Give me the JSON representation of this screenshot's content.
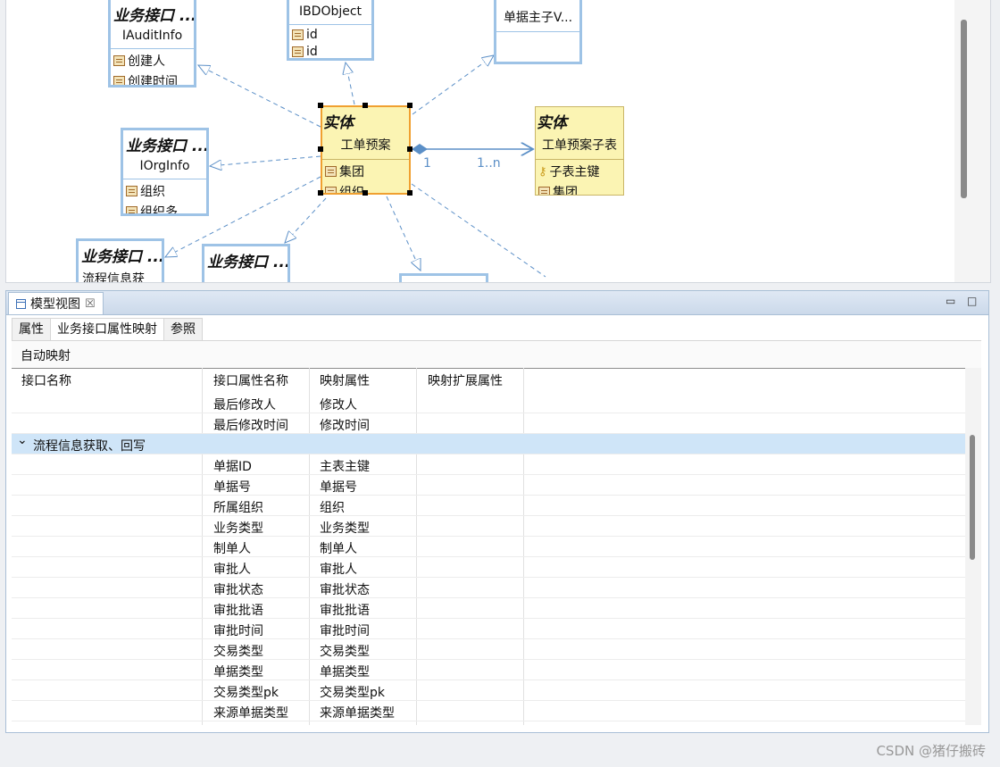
{
  "diagram": {
    "boxes": {
      "iaudit": {
        "stereotype": "业务接口 ...",
        "name": "IAuditInfo",
        "attrs": [
          "创建人",
          "创建时间"
        ]
      },
      "ibdobject": {
        "name": "IBDObject",
        "attrs": [
          "id",
          "id"
        ]
      },
      "billmain": {
        "name": "单据主子V..."
      },
      "iorg": {
        "stereotype": "业务接口 ...",
        "name": "IOrgInfo",
        "attrs": [
          "组织",
          "组织多"
        ]
      },
      "flowinfo": {
        "stereotype": "业务接口 ...",
        "name": "流程信息获"
      },
      "biz5": {
        "stereotype": "业务接口 ..."
      },
      "entity_main": {
        "stereotype": "实体",
        "name": "工单预案",
        "attrs": [
          "集团",
          "组织"
        ]
      },
      "entity_child": {
        "stereotype": "实体",
        "name": "工单预案子表",
        "attrs": [
          "子表主键",
          "集团"
        ]
      }
    },
    "multiplicity_left": "1",
    "multiplicity_right": "1..n"
  },
  "panel": {
    "title": "模型视图",
    "close": "☒",
    "minimize": "▭",
    "maximize": "□",
    "tabs": [
      "属性",
      "业务接口属性映射",
      "参照"
    ],
    "toolbar_label": "自动映射",
    "columns": [
      "接口名称",
      "接口属性名称",
      "映射属性",
      "映射扩展属性"
    ],
    "rows": [
      {
        "interface": "",
        "attr": "最后修改人",
        "mapped": "修改人",
        "ext": ""
      },
      {
        "interface": "",
        "attr": "最后修改时间",
        "mapped": "修改时间",
        "ext": ""
      },
      {
        "group": true,
        "interface": "流程信息获取、回写",
        "attr": "",
        "mapped": "",
        "ext": ""
      },
      {
        "interface": "",
        "attr": "单据ID",
        "mapped": "主表主键",
        "ext": ""
      },
      {
        "interface": "",
        "attr": "单据号",
        "mapped": "单据号",
        "ext": ""
      },
      {
        "interface": "",
        "attr": "所属组织",
        "mapped": "组织",
        "ext": ""
      },
      {
        "interface": "",
        "attr": "业务类型",
        "mapped": "业务类型",
        "ext": ""
      },
      {
        "interface": "",
        "attr": "制单人",
        "mapped": "制单人",
        "ext": ""
      },
      {
        "interface": "",
        "attr": "审批人",
        "mapped": "审批人",
        "ext": ""
      },
      {
        "interface": "",
        "attr": "审批状态",
        "mapped": "审批状态",
        "ext": ""
      },
      {
        "interface": "",
        "attr": "审批批语",
        "mapped": "审批批语",
        "ext": ""
      },
      {
        "interface": "",
        "attr": "审批时间",
        "mapped": "审批时间",
        "ext": ""
      },
      {
        "interface": "",
        "attr": "交易类型",
        "mapped": "交易类型",
        "ext": ""
      },
      {
        "interface": "",
        "attr": "单据类型",
        "mapped": "单据类型",
        "ext": ""
      },
      {
        "interface": "",
        "attr": "交易类型pk",
        "mapped": "交易类型pk",
        "ext": ""
      },
      {
        "interface": "",
        "attr": "来源单据类型",
        "mapped": "来源单据类型",
        "ext": ""
      }
    ]
  },
  "watermark": "CSDN @猪仔搬砖"
}
